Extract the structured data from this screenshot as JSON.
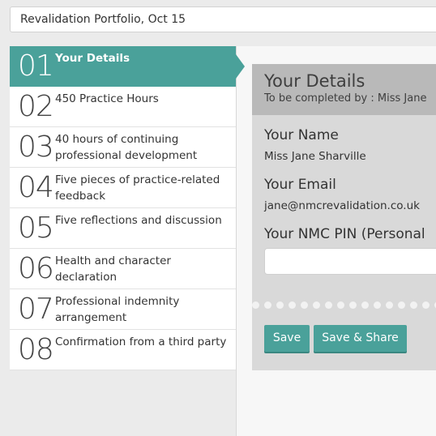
{
  "topbar": {
    "portfolio": "Revalidation Portfolio, Oct 15"
  },
  "steps": [
    {
      "num": "01",
      "label": "Your Details",
      "active": true
    },
    {
      "num": "02",
      "label": "450 Practice Hours"
    },
    {
      "num": "03",
      "label": "40 hours of continuing professional development"
    },
    {
      "num": "04",
      "label": "Five pieces of practice-related feedback"
    },
    {
      "num": "05",
      "label": "Five reflections and discussion"
    },
    {
      "num": "06",
      "label": "Health and character declaration"
    },
    {
      "num": "07",
      "label": "Professional indemnity arrangement"
    },
    {
      "num": "08",
      "label": "Confirmation from a third party"
    }
  ],
  "card": {
    "title": "Your Details",
    "subtitle": "To be completed by : Miss Jane",
    "name_label": "Your Name",
    "name_value": "Miss Jane Sharville",
    "email_label": "Your Email",
    "email_value": "jane@nmcrevalidation.co.uk",
    "pin_label": "Your NMC PIN (Personal",
    "pin_value": "",
    "save_label": "Save",
    "save_share_label": "Save & Share"
  },
  "colors": {
    "accent": "#4aa19a",
    "card_bg": "#d9d9d9",
    "card_header_bg": "#b9b9b9"
  }
}
